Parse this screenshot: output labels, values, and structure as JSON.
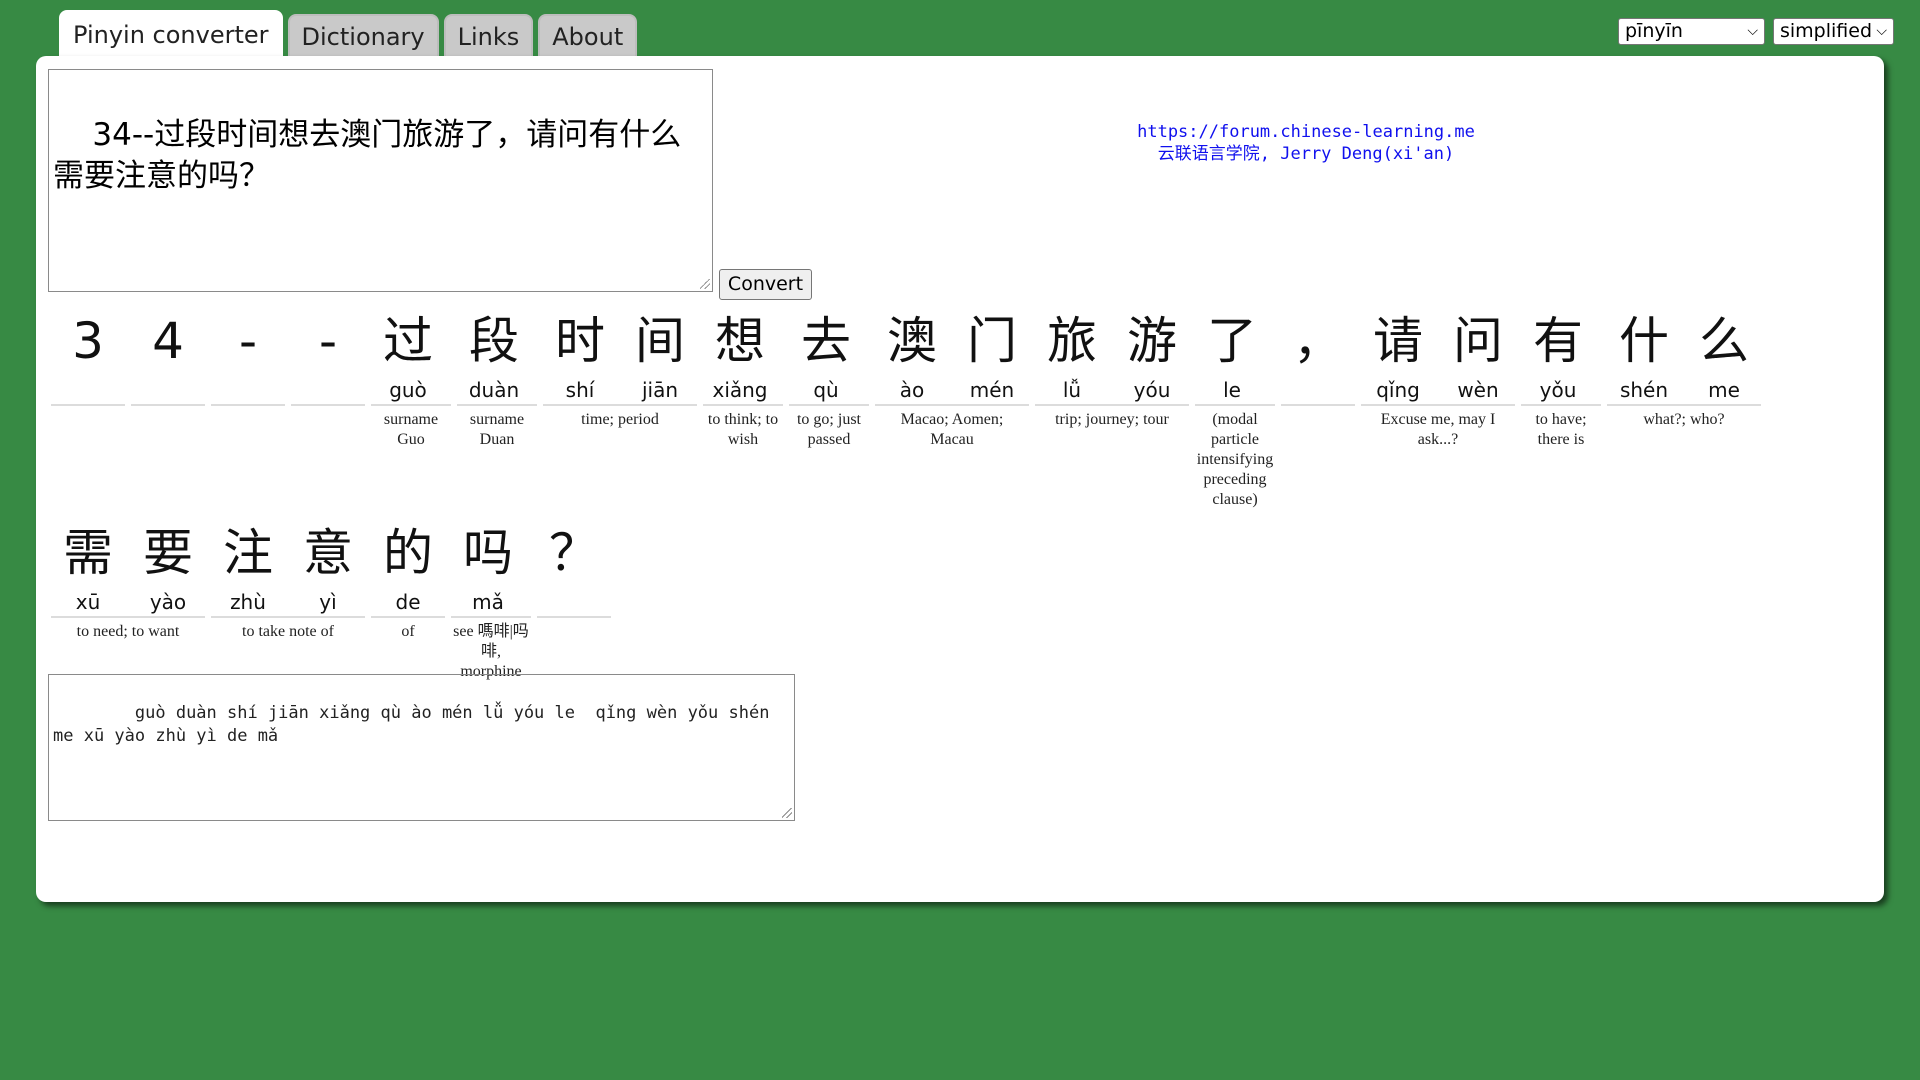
{
  "tabs": [
    {
      "label": "Pinyin converter",
      "active": true
    },
    {
      "label": "Dictionary",
      "active": false
    },
    {
      "label": "Links",
      "active": false
    },
    {
      "label": "About",
      "active": false
    }
  ],
  "selects": {
    "romanization": {
      "selected": "pīnyīn"
    },
    "script": {
      "selected": "simplified"
    }
  },
  "input": {
    "value": "34--过段时间想去澳门旅游了，请问有什么需要注意的吗？"
  },
  "convert_button": {
    "label": "Convert"
  },
  "credit": {
    "url": "https://forum.chinese-learning.me",
    "author": "云联语言学院, Jerry Deng(xi'an)"
  },
  "words": [
    {
      "chars": [
        {
          "han": "3",
          "py": ""
        }
      ],
      "gloss": ""
    },
    {
      "chars": [
        {
          "han": "4",
          "py": ""
        }
      ],
      "gloss": ""
    },
    {
      "chars": [
        {
          "han": "-",
          "py": ""
        }
      ],
      "gloss": ""
    },
    {
      "chars": [
        {
          "han": "-",
          "py": ""
        }
      ],
      "gloss": ""
    },
    {
      "chars": [
        {
          "han": "过",
          "py": "guò"
        }
      ],
      "gloss": "surname Guo"
    },
    {
      "chars": [
        {
          "han": "段",
          "py": "duàn"
        }
      ],
      "gloss": "surname Duan"
    },
    {
      "chars": [
        {
          "han": "时",
          "py": "shí"
        },
        {
          "han": "间",
          "py": "jiān"
        }
      ],
      "gloss": "time; period"
    },
    {
      "chars": [
        {
          "han": "想",
          "py": "xiǎng"
        }
      ],
      "gloss": "to think; to wish"
    },
    {
      "chars": [
        {
          "han": "去",
          "py": "qù"
        }
      ],
      "gloss": "to go; just passed"
    },
    {
      "chars": [
        {
          "han": "澳",
          "py": "ào"
        },
        {
          "han": "门",
          "py": "mén"
        }
      ],
      "gloss": "Macao; Aomen; Macau"
    },
    {
      "chars": [
        {
          "han": "旅",
          "py": "lǚ"
        },
        {
          "han": "游",
          "py": "yóu"
        }
      ],
      "gloss": "trip; journey; tour"
    },
    {
      "chars": [
        {
          "han": "了",
          "py": "le"
        }
      ],
      "gloss": "(modal particle intensifying preceding clause)"
    },
    {
      "chars": [
        {
          "han": "，",
          "py": ""
        }
      ],
      "gloss": ""
    },
    {
      "chars": [
        {
          "han": "请",
          "py": "qǐng"
        },
        {
          "han": "问",
          "py": "wèn"
        }
      ],
      "gloss": "Excuse me, may I ask...?"
    },
    {
      "chars": [
        {
          "han": "有",
          "py": "yǒu"
        }
      ],
      "gloss": "to have; there is"
    },
    {
      "chars": [
        {
          "han": "什",
          "py": "shén"
        },
        {
          "han": "么",
          "py": "me"
        }
      ],
      "gloss": "what?; who?"
    },
    {
      "chars": [
        {
          "han": "需",
          "py": "xū"
        },
        {
          "han": "要",
          "py": "yào"
        }
      ],
      "gloss": "to need; to want"
    },
    {
      "chars": [
        {
          "han": "注",
          "py": "zhù"
        },
        {
          "han": "意",
          "py": "yì"
        }
      ],
      "gloss": "to take note of"
    },
    {
      "chars": [
        {
          "han": "的",
          "py": "de"
        }
      ],
      "gloss": "of"
    },
    {
      "chars": [
        {
          "han": "吗",
          "py": "mǎ"
        }
      ],
      "gloss": "see 嗎啡|吗啡, morphine"
    },
    {
      "chars": [
        {
          "han": "？",
          "py": ""
        }
      ],
      "gloss": ""
    }
  ],
  "output": {
    "value": "    guò duàn shí jiān xiǎng qù ào mén lǚ yóu le  qǐng wèn yǒu shén me xū yào zhù yì de mǎ"
  }
}
